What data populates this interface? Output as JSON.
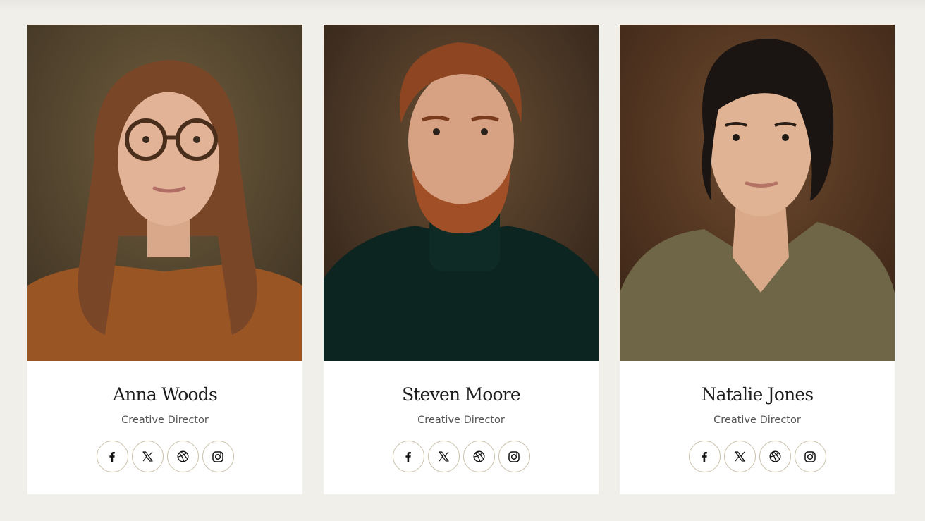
{
  "team": [
    {
      "name": "Anna Woods",
      "role": "Creative Director",
      "photo": {
        "background": "#5b4a32",
        "clothing": "#9a5524",
        "hair": "#7a4628",
        "skin": "#e2b397"
      }
    },
    {
      "name": "Steven Moore",
      "role": "Creative Director",
      "photo": {
        "background": "#4a3626",
        "clothing": "#0d2521",
        "hair": "#8e4522",
        "skin": "#d7a183"
      }
    },
    {
      "name": "Natalie Jones",
      "role": "Creative Director",
      "photo": {
        "background": "#5a3a24",
        "clothing": "#6f6547",
        "hair": "#1a1512",
        "skin": "#e0b394"
      }
    }
  ],
  "social_icons": [
    "facebook-icon",
    "x-twitter-icon",
    "dribbble-icon",
    "instagram-icon"
  ],
  "colors": {
    "page_background": "#f0efe9",
    "card_background": "#ffffff",
    "icon_border": "#cbc3ad",
    "text": "#1d1d1d"
  }
}
